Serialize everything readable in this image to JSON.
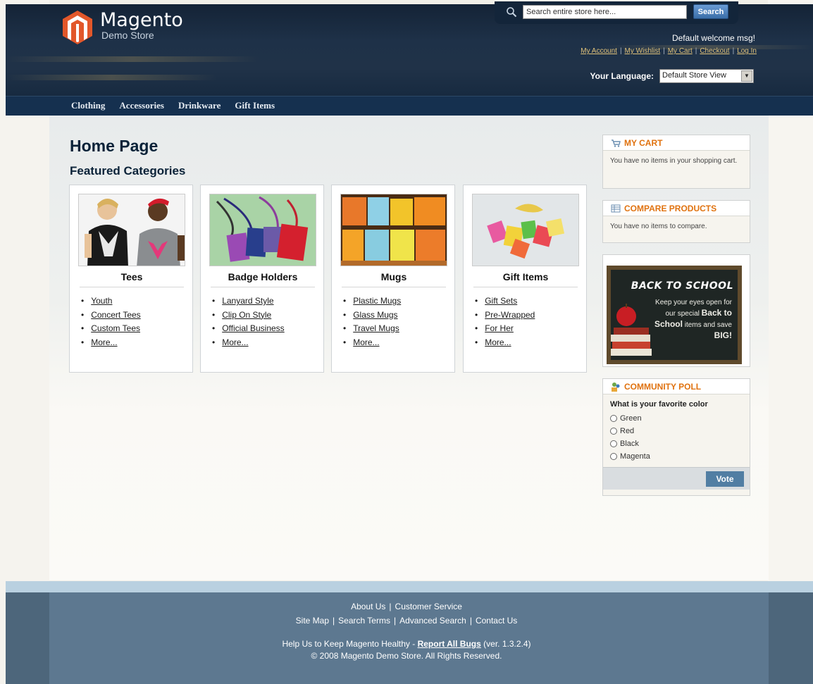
{
  "header": {
    "logo_title": "Magento",
    "logo_subtitle": "Demo Store",
    "search_placeholder": "Search entire store here...",
    "search_button": "Search",
    "welcome": "Default welcome msg!",
    "links": [
      "My Account",
      "My Wishlist",
      "My Cart",
      "Checkout",
      "Log In"
    ],
    "language_label": "Your Language:",
    "language_value": "Default Store View"
  },
  "nav": [
    "Clothing",
    "Accessories",
    "Drinkware",
    "Gift Items"
  ],
  "main": {
    "title": "Home Page",
    "featured": "Featured Categories",
    "categories": [
      {
        "title": "Tees",
        "items": [
          "Youth",
          "Concert Tees",
          "Custom Tees",
          "More..."
        ]
      },
      {
        "title": "Badge Holders",
        "items": [
          "Lanyard Style",
          "Clip On Style",
          "Official Business",
          "More..."
        ]
      },
      {
        "title": "Mugs",
        "items": [
          "Plastic Mugs",
          "Glass Mugs",
          "Travel Mugs",
          "More..."
        ]
      },
      {
        "title": "Gift Items",
        "items": [
          "Gift Sets",
          "Pre-Wrapped",
          "For Her",
          "More..."
        ]
      }
    ]
  },
  "sidebar": {
    "cart_title": "MY CART",
    "cart_text": "You have no items in your shopping cart.",
    "compare_title": "COMPARE PRODUCTS",
    "compare_text": "You have no items to compare.",
    "promo_heading": "BACK TO SCHOOL",
    "promo_text_1": "Keep your eyes open for our special",
    "promo_bold_1": "Back to School",
    "promo_text_2": "items and save",
    "promo_bold_2": "BIG!",
    "poll_title": "COMMUNITY POLL",
    "poll_question": "What is your favorite color",
    "poll_options": [
      "Green",
      "Red",
      "Black",
      "Magenta"
    ],
    "vote_button": "Vote"
  },
  "footer": {
    "row1": [
      "About Us",
      "Customer Service"
    ],
    "row2": [
      "Site Map",
      "Search Terms",
      "Advanced Search",
      "Contact Us"
    ],
    "help_prefix": "Help Us to Keep Magento Healthy -",
    "help_link": "Report All Bugs",
    "help_suffix": "(ver. 1.3.2.4)",
    "copyright": "© 2008 Magento Demo Store. All Rights Reserved."
  }
}
